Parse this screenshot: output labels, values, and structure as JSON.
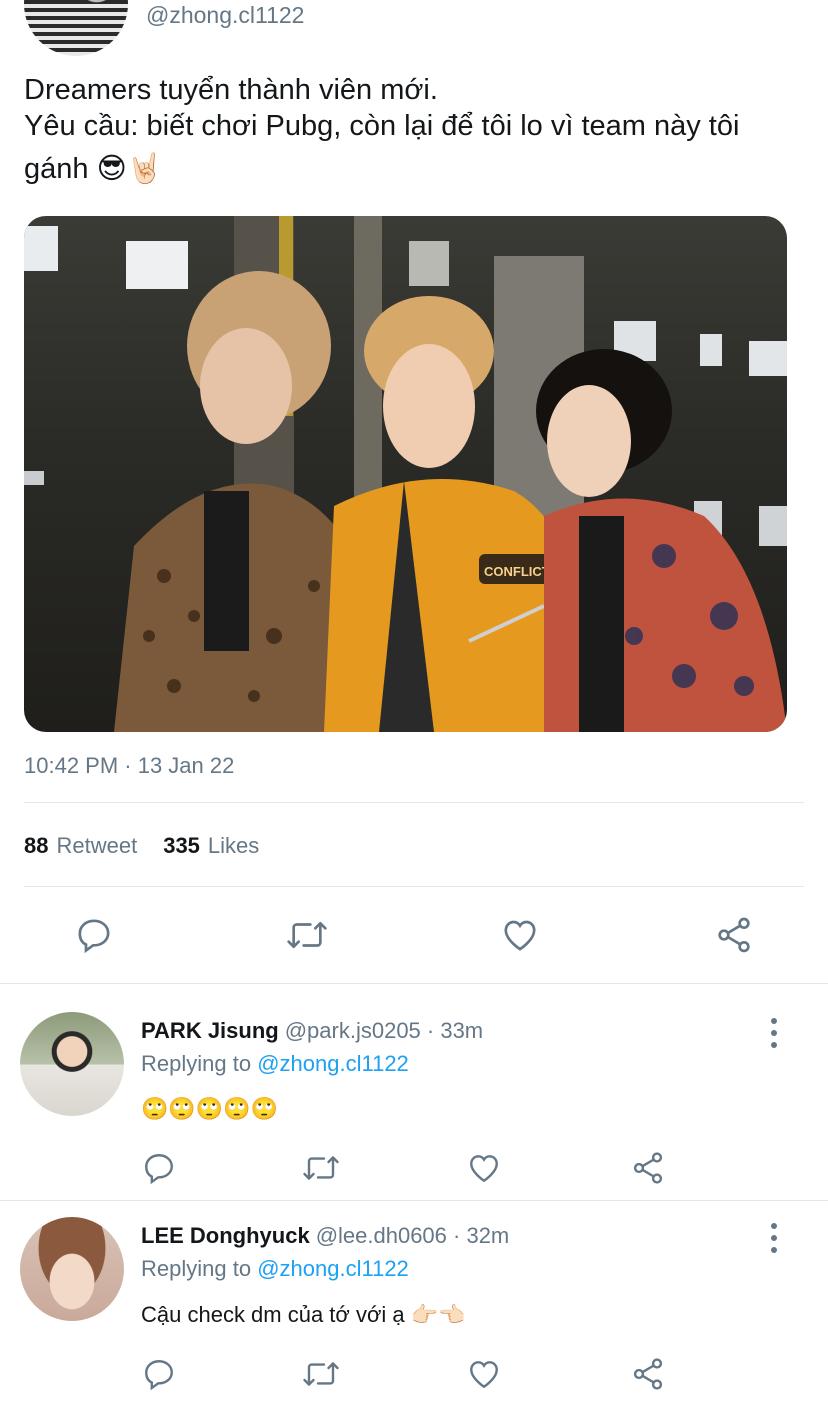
{
  "author": {
    "handle": "@zhong.cl1122"
  },
  "tweet": {
    "lines": [
      "Dreamers tuyển thành viên mới.",
      "Yêu cầu: biết chơi Pubg, còn lại để tôi lo vì team này tôi",
      "gánh 😎🤘🏻"
    ],
    "media_text": "CONFLICT",
    "timestamp": "10:42 PM · 13 Jan 22",
    "retweet_count": "88",
    "retweet_label": "Retweet",
    "likes_count": "335",
    "likes_label": "Likes"
  },
  "replies": [
    {
      "name": "PARK Jisung",
      "meta": "@park.js0205 · 33m",
      "replying_prefix": "Replying to",
      "replying_to": "@zhong.cl1122",
      "body": "🙄🙄🙄🙄🙄"
    },
    {
      "name": "LEE Donghyuck",
      "meta": "@lee.dh0606 · 32m",
      "replying_prefix": "Replying to",
      "replying_to": "@zhong.cl1122",
      "body": "Cậu check dm của tớ với ạ 👉🏻👈🏻"
    }
  ],
  "icons": {
    "reply": "reply-icon",
    "retweet": "retweet-icon",
    "like": "heart-icon",
    "share": "share-icon",
    "more": "more-vertical-icon"
  },
  "colors": {
    "link": "#1da1f2",
    "muted": "#657786",
    "text": "#14171a"
  }
}
